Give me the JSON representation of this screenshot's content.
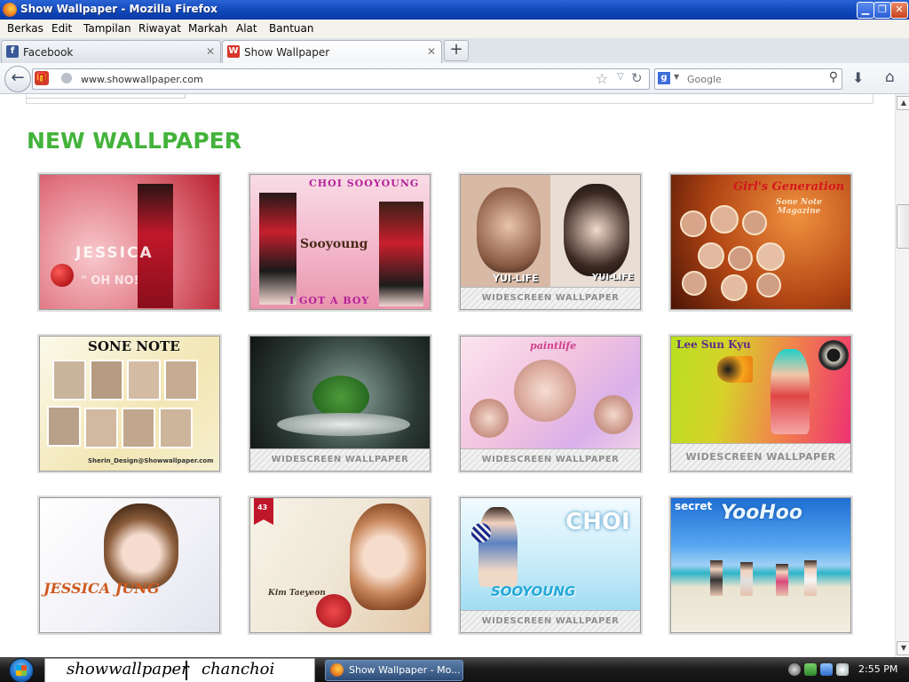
{
  "window": {
    "title": "Show Wallpaper - Mozilla Firefox",
    "controls": {
      "minimize": "▁",
      "restore": "❐",
      "close": "✕"
    }
  },
  "menu": [
    "Berkas",
    "Edit",
    "Tampilan",
    "Riwayat",
    "Markah",
    "Alat",
    "Bantuan"
  ],
  "tabs": [
    {
      "label": "Facebook",
      "icon": "f",
      "close": "✕"
    },
    {
      "label": "Show Wallpaper",
      "icon": "W",
      "close": "✕"
    }
  ],
  "new_tab": "+",
  "navbar": {
    "back": "←",
    "url": "www.showwallpaper.com",
    "bookmark_star": "☆",
    "dropdown": "▽",
    "reload": "↻",
    "search_engine": "g",
    "search_dropdown": "▼",
    "search_placeholder": "Google",
    "search_icon": "⚲",
    "download_icon": "⬇",
    "home_icon": "⌂"
  },
  "page": {
    "heading": "NEW WALLPAPER",
    "widescreen_label": "WIDESCREEN WALLPAPER",
    "thumbs": [
      {
        "overlay": "JESSICA",
        "overlay2": "\" OH NO!",
        "colors": [
          "#f0aab0",
          "#c1283a"
        ]
      },
      {
        "overlay": "CHOI SOOYOUNG",
        "overlay2": "Sooyoung",
        "overlay3": "I GOT A BOY",
        "colors": [
          "#f6c6d8",
          "#c93a55"
        ]
      },
      {
        "overlay": "YUI-LIFE",
        "overlay2": "YUI-LIFE",
        "colors": [
          "#d9b8a4",
          "#6a4e3e"
        ]
      },
      {
        "overlay": "Girl's Generation",
        "overlay2": "Sone Note Magazine",
        "colors": [
          "#d96a30",
          "#5e1d08"
        ]
      },
      {
        "overlay": "SONE NOTE",
        "overlay2": "Sherin_Design@Showwallpaper.com",
        "colors": [
          "#f7f3d6",
          "#c9b87a"
        ]
      },
      {
        "overlay": "",
        "colors": [
          "#7f8c86",
          "#121714"
        ]
      },
      {
        "overlay": "paintlife",
        "colors": [
          "#f7d2e6",
          "#d6a3e0"
        ]
      },
      {
        "overlay": "Lee Sun Kyu",
        "colors": [
          "#b7e01f",
          "#ee2d74"
        ]
      },
      {
        "overlay": "JESSICA JUNG",
        "colors": [
          "#fbfbfb",
          "#d9d9e4"
        ]
      },
      {
        "overlay": "Kim Taeyeon",
        "badge": "43",
        "colors": [
          "#f3efe3",
          "#d5c5b2"
        ]
      },
      {
        "overlay": "CHOI",
        "overlay2": "SOOYOUNG",
        "colors": [
          "#dff2fb",
          "#6cc3e6"
        ]
      },
      {
        "overlay": "secret",
        "overlay2": "YooHoo",
        "colors": [
          "#2d7fd8",
          "#e8e3d4"
        ]
      }
    ]
  },
  "scrollbar": {
    "up": "▲",
    "down": "▼"
  },
  "taskbar": {
    "banner_left": "showwallpaper",
    "banner_right": "chanchoi",
    "task_label": "Show Wallpaper - Mo...",
    "clock": "2:55 PM"
  }
}
